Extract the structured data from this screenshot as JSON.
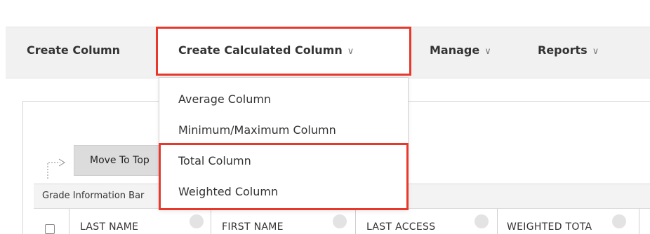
{
  "toolbar": {
    "create_column": "Create Column",
    "create_calculated_column": "Create Calculated Column",
    "manage": "Manage",
    "reports": "Reports",
    "chevron": "∨"
  },
  "dropdown": {
    "items": [
      "Average Column",
      "Minimum/Maximum Column",
      "Total Column",
      "Weighted Column"
    ]
  },
  "grid": {
    "move_to_top": "Move To Top",
    "grade_information": "Grade Information Bar",
    "columns": [
      "LAST NAME",
      "FIRST NAME",
      "LAST ACCESS",
      "WEIGHTED TOTA"
    ]
  },
  "colors": {
    "highlight": "#e8382c",
    "action_bar_bg": "#f1f1f1"
  }
}
